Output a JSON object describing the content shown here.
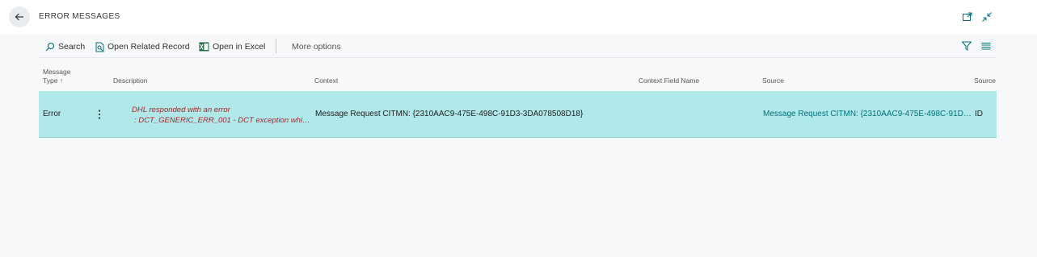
{
  "header": {
    "title": "ERROR MESSAGES",
    "icons": [
      "back-arrow-icon",
      "open-new-window-icon",
      "collapse-icon"
    ]
  },
  "actions": {
    "search": "Search",
    "open_related": "Open Related Record",
    "open_excel": "Open in Excel",
    "more_options": "More options",
    "icons": [
      "search-icon",
      "related-record-icon",
      "excel-icon",
      "filter-icon",
      "list-view-icon"
    ]
  },
  "columns": {
    "message_type_line1": "Message",
    "message_type_line2": "Type",
    "sort_indicator": "↑",
    "description": "Description",
    "context": "Context",
    "context_field_name": "Context Field Name",
    "source": "Source",
    "source_id": "Source"
  },
  "rows": [
    {
      "message_type": "Error",
      "description_line1": "DHL responded with an error",
      "description_line2": ": DCT_GENERIC_ERR_001 - DCT exception while...",
      "context": "Message Request CITMN: {2310AAC9-475E-498C-91D3-3DA078508D18}",
      "context_field_name": "",
      "source": "Message Request CITMN: {2310AAC9-475E-498C-91D3...",
      "source_id": "ID"
    }
  ],
  "colors": {
    "selected_row": "#b1e8ea",
    "error_text": "#a4262c",
    "link_text": "#00707a",
    "accent": "#00707a"
  }
}
